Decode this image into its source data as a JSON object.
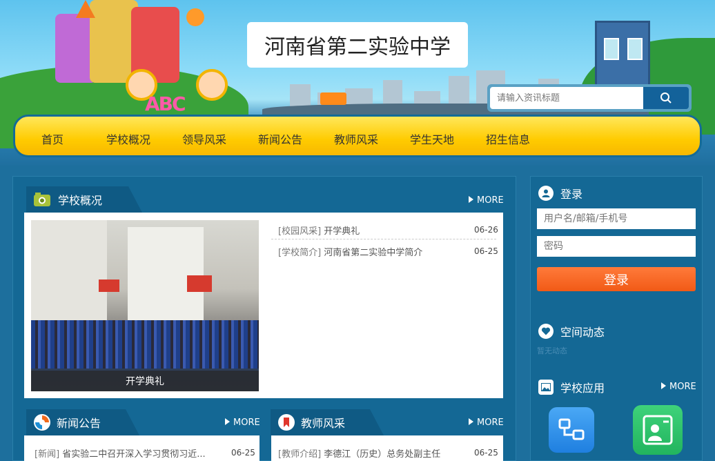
{
  "header": {
    "school_name": "河南省第二实验中学",
    "search_placeholder": "请输入资讯标题",
    "abc_text": "ABC"
  },
  "nav": {
    "items": [
      "首页",
      "学校概况",
      "领导风采",
      "新闻公告",
      "教师风采",
      "学生天地",
      "招生信息"
    ]
  },
  "school_overview": {
    "title": "学校概况",
    "more": "MORE",
    "photo_caption": "开学典礼",
    "items": [
      {
        "category": "[校园风采]",
        "title": "开学典礼",
        "date": "06-26"
      },
      {
        "category": "[学校简介]",
        "title": "河南省第二实验中学简介",
        "date": "06-25"
      }
    ]
  },
  "news": {
    "title": "新闻公告",
    "more": "MORE",
    "items": [
      {
        "category": "[新闻]",
        "title": "省实验二中召开深入学习贯彻习近...",
        "date": "06-25"
      }
    ]
  },
  "teachers": {
    "title": "教师风采",
    "more": "MORE",
    "items": [
      {
        "category": "[教师介绍]",
        "title": "李德江（历史）总务处副主任",
        "date": "06-25"
      }
    ]
  },
  "login": {
    "title": "登录",
    "username_placeholder": "用户名/邮箱/手机号",
    "password_placeholder": "密码",
    "button": "登录"
  },
  "space": {
    "title": "空间动态",
    "empty": "暂无动态"
  },
  "apps": {
    "title": "学校应用",
    "more": "MORE"
  },
  "colors": {
    "background": "#1d6f9d",
    "nav_yellow": "#ffcb00",
    "login_orange": "#f15a16",
    "app_blue": "#2f8ee8",
    "app_green": "#2ec26a"
  }
}
